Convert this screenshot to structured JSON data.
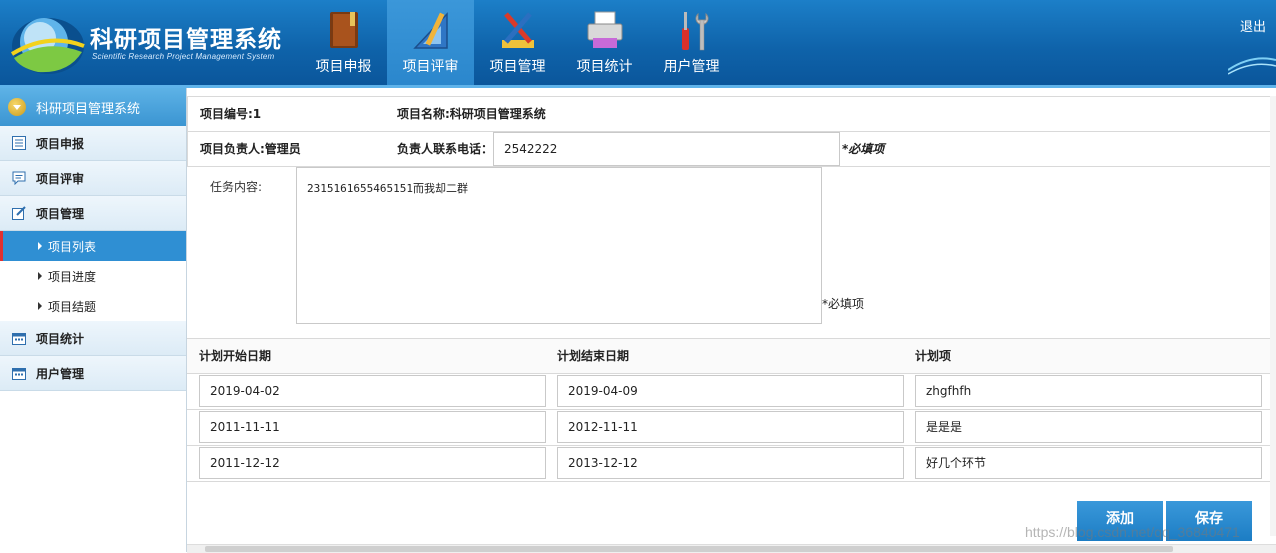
{
  "header": {
    "title": "科研项目管理系统",
    "subtitle": "Scientific Research Project Management System",
    "logout": "退出",
    "nav": [
      {
        "label": "项目申报",
        "icon": "book-icon"
      },
      {
        "label": "项目评审",
        "icon": "ruler-pencil-icon"
      },
      {
        "label": "项目管理",
        "icon": "tools-icon"
      },
      {
        "label": "项目统计",
        "icon": "printer-icon"
      },
      {
        "label": "用户管理",
        "icon": "wrench-screwdriver-icon"
      }
    ],
    "active_nav_index": 1
  },
  "sidebar": {
    "title": "科研项目管理系统",
    "groups": {
      "apply": "项目申报",
      "review": "项目评审",
      "manage": "项目管理",
      "stats": "项目统计",
      "users": "用户管理"
    },
    "manage_items": [
      "项目列表",
      "项目进度",
      "项目结题"
    ],
    "active_item": "项目列表"
  },
  "form": {
    "project_no": "项目编号:1",
    "project_name": "项目名称:科研项目管理系统",
    "leader": "项目负责人:管理员",
    "phone_label": "负责人联系电话：",
    "phone_value": "2542222",
    "phone_required": "*必填项",
    "task_label": "任务内容:",
    "task_value": "2315161655465151而我却二群",
    "task_required": "*必填项"
  },
  "plan": {
    "headers": [
      "计划开始日期",
      "计划结束日期",
      "计划项"
    ],
    "rows": [
      [
        "2019-04-02",
        "2019-04-09",
        "zhgfhfh"
      ],
      [
        "2011-11-11",
        "2012-11-11",
        "是是是"
      ],
      [
        "2011-12-12",
        "2013-12-12",
        "好几个环节"
      ]
    ]
  },
  "buttons": {
    "add": "添加",
    "save": "保存"
  },
  "watermark": "https://blog.csdn.net/qq_36840471",
  "colors": {
    "header_blue": "#0f63aa",
    "active_blue": "#2f8fd3",
    "button_blue": "#1c7dc4",
    "active_marker": "#e03030"
  }
}
